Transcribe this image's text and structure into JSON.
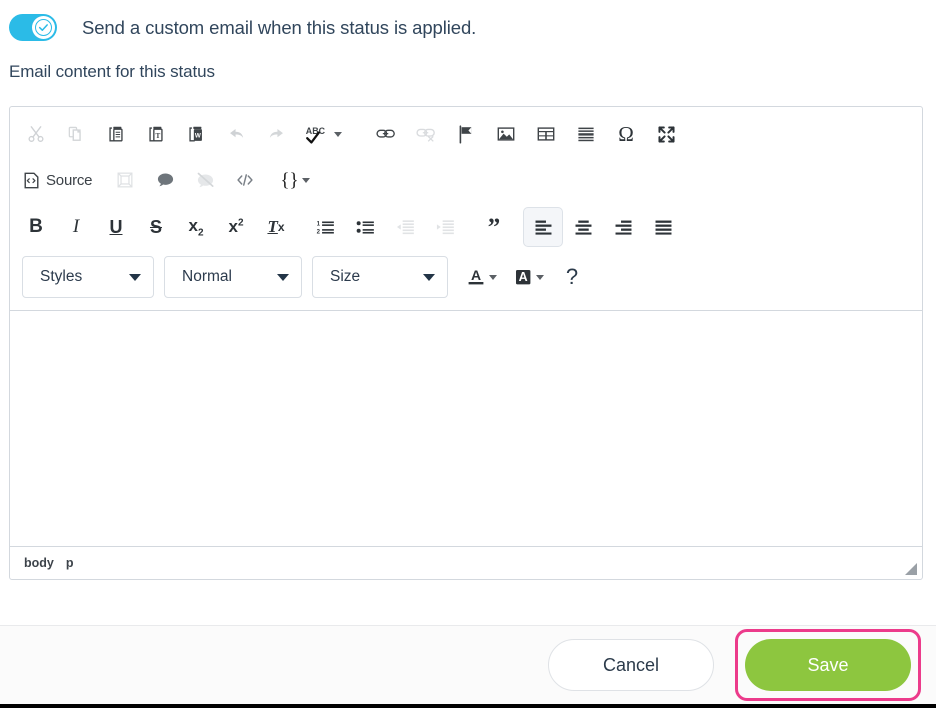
{
  "toggle": {
    "label": "Send a custom email when this status is applied.",
    "state": "on",
    "icon": "check-icon",
    "color_on": "#2bbbe7"
  },
  "section": {
    "heading": "Email content for this status"
  },
  "editor": {
    "toolbar_rows": [
      {
        "row": 1,
        "buttons": [
          {
            "name": "cut-icon",
            "title": "Cut",
            "disabled": true
          },
          {
            "name": "copy-icon",
            "title": "Copy",
            "disabled": true
          },
          {
            "name": "paste-icon",
            "title": "Paste",
            "disabled": false
          },
          {
            "name": "paste-as-plain-text-icon",
            "title": "Paste as plain text",
            "disabled": false
          },
          {
            "name": "paste-from-word-icon",
            "title": "Paste from Word",
            "disabled": false
          },
          {
            "name": "undo-icon",
            "title": "Undo",
            "disabled": true
          },
          {
            "name": "redo-icon",
            "title": "Redo",
            "disabled": true
          },
          {
            "name": "spell-check-icon",
            "title": "Spell Check As You Type",
            "label": "ABC",
            "disabled": false
          },
          {
            "name": "link-icon",
            "title": "Link",
            "disabled": false
          },
          {
            "name": "unlink-icon",
            "title": "Unlink",
            "disabled": true
          },
          {
            "name": "anchor-flag-icon",
            "title": "Anchor",
            "disabled": false
          },
          {
            "name": "image-icon",
            "title": "Image",
            "disabled": false
          },
          {
            "name": "table-icon",
            "title": "Table",
            "disabled": false
          },
          {
            "name": "horizontal-rule-icon",
            "title": "Horizontal Line",
            "disabled": false
          },
          {
            "name": "special-character-icon",
            "title": "Insert Special Character",
            "label": "Ω",
            "disabled": false
          },
          {
            "name": "maximize-icon",
            "title": "Maximize",
            "disabled": false
          }
        ]
      },
      {
        "row": 2,
        "source_label": "Source",
        "buttons": [
          {
            "name": "source-icon",
            "title": "Source",
            "disabled": false
          },
          {
            "name": "show-blocks-icon",
            "title": "Show Blocks",
            "disabled": true
          },
          {
            "name": "comment-icon",
            "title": "Comment",
            "disabled": false
          },
          {
            "name": "hide-icon",
            "title": "Hide",
            "disabled": true
          },
          {
            "name": "code-snippet-icon",
            "title": "Insert Code Snippet",
            "disabled": false
          },
          {
            "name": "placeholder-icon",
            "title": "Placeholders",
            "label": "{}",
            "disabled": false
          }
        ]
      },
      {
        "row": 3,
        "buttons": [
          {
            "name": "bold-icon",
            "title": "Bold",
            "label": "B",
            "disabled": false
          },
          {
            "name": "italic-icon",
            "title": "Italic",
            "label": "I",
            "disabled": false
          },
          {
            "name": "underline-icon",
            "title": "Underline",
            "label": "U",
            "disabled": false
          },
          {
            "name": "strikethrough-icon",
            "title": "Strikethrough",
            "label": "S",
            "disabled": false
          },
          {
            "name": "subscript-icon",
            "title": "Subscript",
            "disabled": false
          },
          {
            "name": "superscript-icon",
            "title": "Superscript",
            "disabled": false
          },
          {
            "name": "remove-format-icon",
            "title": "Remove Format",
            "disabled": false
          },
          {
            "name": "numbered-list-icon",
            "title": "Insert/Remove Numbered List",
            "disabled": false
          },
          {
            "name": "bulleted-list-icon",
            "title": "Insert/Remove Bulleted List",
            "disabled": false
          },
          {
            "name": "decrease-indent-icon",
            "title": "Decrease Indent",
            "disabled": true
          },
          {
            "name": "increase-indent-icon",
            "title": "Increase Indent",
            "disabled": true
          },
          {
            "name": "blockquote-icon",
            "title": "Block Quote",
            "disabled": false
          },
          {
            "name": "align-left-icon",
            "title": "Align Left",
            "disabled": false,
            "active": true
          },
          {
            "name": "align-center-icon",
            "title": "Center",
            "disabled": false
          },
          {
            "name": "align-right-icon",
            "title": "Align Right",
            "disabled": false
          },
          {
            "name": "justify-icon",
            "title": "Justify",
            "disabled": false
          }
        ]
      },
      {
        "row": 4,
        "styles_label": "Styles",
        "format_label": "Normal",
        "size_label": "Size",
        "text_color_name": "text-color-icon",
        "bg_color_name": "background-color-icon",
        "help_label": "?"
      }
    ],
    "content": "",
    "elements_path": [
      "body",
      "p"
    ],
    "resize_grip": "resize-grip-icon"
  },
  "footer": {
    "cancel_label": "Cancel",
    "save_label": "Save",
    "save_color": "#8dc63f",
    "highlight_color": "#ec3b8b"
  }
}
